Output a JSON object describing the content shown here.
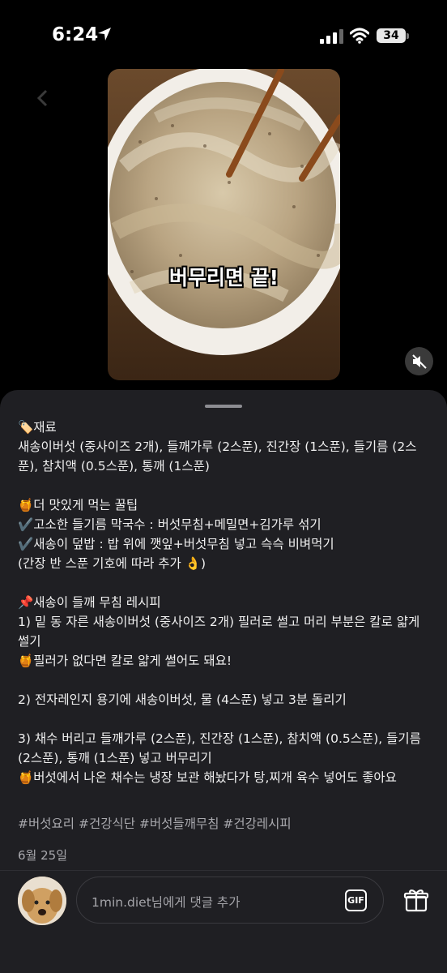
{
  "status_bar": {
    "time": "6:24",
    "battery": "34"
  },
  "video": {
    "caption": "버무리면 끝!"
  },
  "post": {
    "lines": [
      "🏷️재료",
      "새송이버섯 (중사이즈 2개), 들깨가루 (2스푼), 진간장 (1스푼), 들기름 (2스",
      "푼), 참치액 (0.5스푼), 통깨 (1스푼)",
      "",
      "🍯더 맛있게 먹는 꿀팁",
      "✔️고소한 들기름 막국수 : 버섯무침+메밀면+김가루 섞기",
      "✔️새송이 덮밥 : 밥 위에 깻잎+버섯무침 넣고 슥슥 비벼먹기",
      "(간장 반 스푼 기호에 따라 추가 👌)",
      "",
      "📌새송이 들깨 무침 레시피",
      "1) 밑 동 자른 새송이버섯 (중사이즈 2개) 필러로 썰고 머리 부분은 칼로 얇게",
      "썰기",
      "🍯필러가 없다면 칼로 얇게 썰어도 돼요!",
      "",
      "2) 전자레인지 용기에 새송이버섯, 물 (4스푼) 넣고 3분 돌리기",
      "",
      "3) 채수 버리고 들깨가루 (2스푼), 진간장 (1스푼), 참치액 (0.5스푼), 들기름",
      "(2스푼), 통깨 (1스푼) 넣고 버무리기",
      "🍯버섯에서 나온 채수는 냉장 보관 해놨다가 탕,찌개 육수 넣어도 좋아요"
    ],
    "hashtags": "#버섯요리 #건강식단 #버섯들깨무침 #건강레시피",
    "date": "6월 25일"
  },
  "comment": {
    "placeholder": "1min.diet님에게 댓글 추가",
    "gif_label": "GIF"
  },
  "icons": {
    "location": "location-arrow-icon",
    "signal": "cellular-signal-icon",
    "wifi": "wifi-icon",
    "mute": "speaker-muted-icon",
    "gift": "gift-icon",
    "back": "chevron-left-icon"
  }
}
